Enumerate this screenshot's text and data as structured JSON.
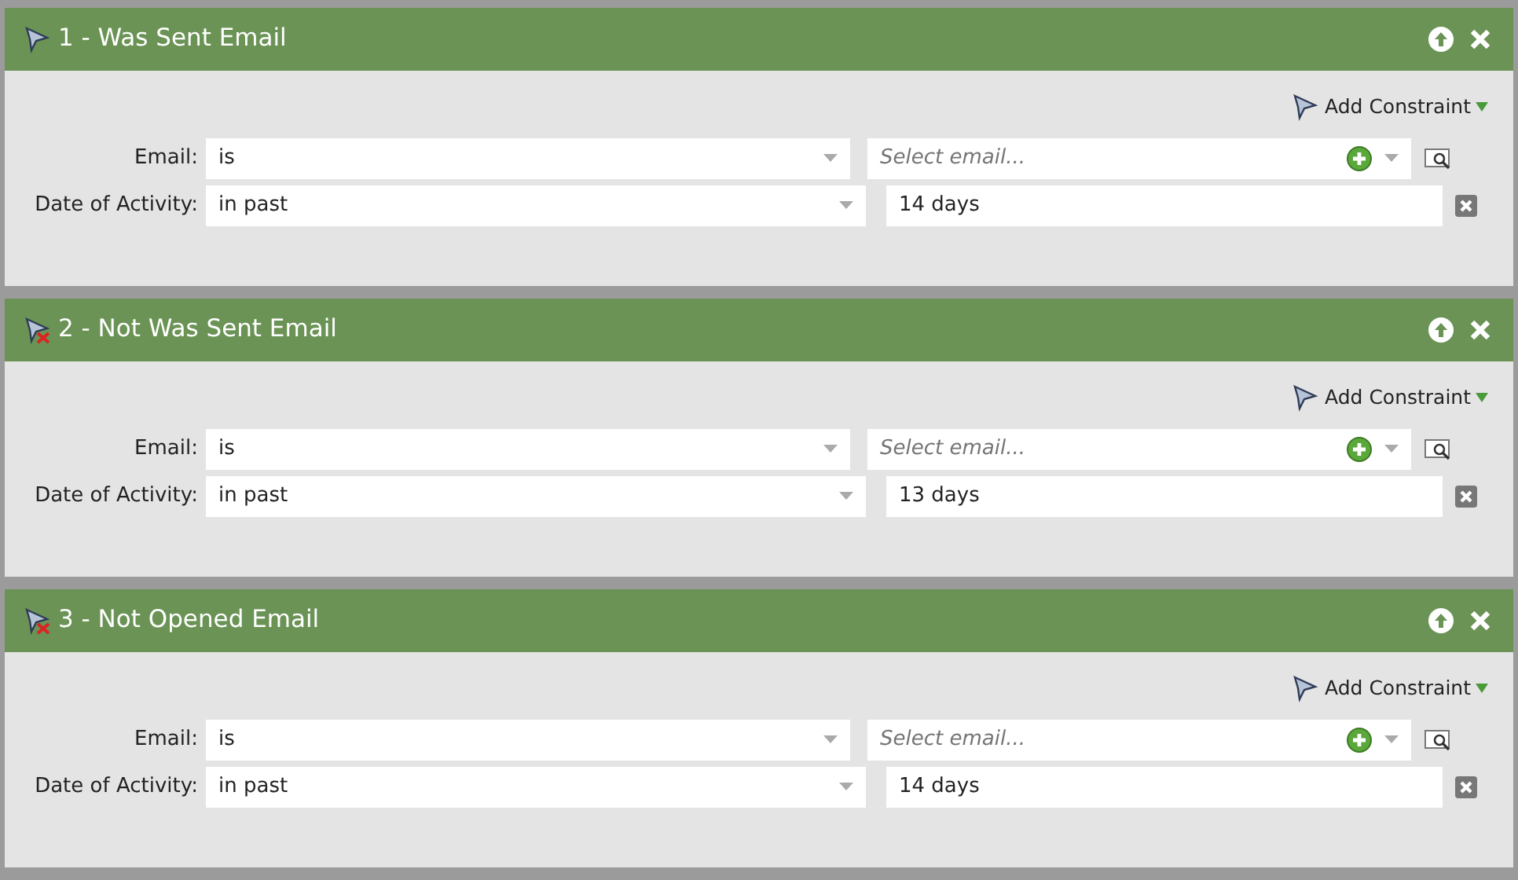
{
  "filters": [
    {
      "title": "1 - Was Sent Email",
      "negated": false,
      "add_constraint": "Add Constraint",
      "email": {
        "label": "Email:",
        "operator": "is",
        "placeholder": "Select email..."
      },
      "date": {
        "label": "Date of Activity:",
        "operator": "in past",
        "value": "14 days"
      }
    },
    {
      "title": "2 - Not Was Sent Email",
      "negated": true,
      "add_constraint": "Add Constraint",
      "email": {
        "label": "Email:",
        "operator": "is",
        "placeholder": "Select email..."
      },
      "date": {
        "label": "Date of Activity:",
        "operator": "in past",
        "value": "13 days"
      }
    },
    {
      "title": "3 - Not Opened Email",
      "negated": true,
      "add_constraint": "Add Constraint",
      "email": {
        "label": "Email:",
        "operator": "is",
        "placeholder": "Select email..."
      },
      "date": {
        "label": "Date of Activity:",
        "operator": "in past",
        "value": "14 days"
      }
    }
  ]
}
